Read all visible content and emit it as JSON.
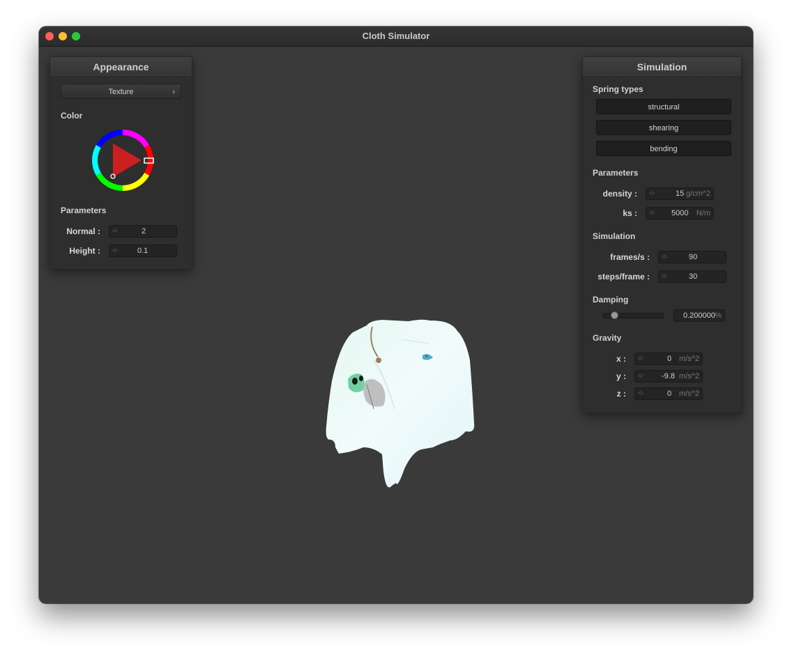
{
  "window": {
    "title": "Cloth Simulator"
  },
  "appearance": {
    "header": "Appearance",
    "texture_button": "Texture",
    "color_label": "Color",
    "parameters_label": "Parameters",
    "normal": {
      "label": "Normal :",
      "value": "2"
    },
    "height": {
      "label": "Height :",
      "value": "0.1"
    }
  },
  "simulation_panel": {
    "header": "Simulation",
    "spring_types_label": "Spring types",
    "spring_buttons": [
      "structural",
      "shearing",
      "bending"
    ],
    "parameters_label": "Parameters",
    "density": {
      "label": "density :",
      "value": "15",
      "unit": "g/cm^2"
    },
    "ks": {
      "label": "ks :",
      "value": "5000",
      "unit": "N/m"
    },
    "simulation_label": "Simulation",
    "fps": {
      "label": "frames/s :",
      "value": "90"
    },
    "steps": {
      "label": "steps/frame :",
      "value": "30"
    },
    "damping_label": "Damping",
    "damping": {
      "value": "0.200000",
      "unit": "%",
      "level": 0.2
    },
    "gravity_label": "Gravity",
    "gx": {
      "label": "x :",
      "value": "0",
      "unit": "m/s^2"
    },
    "gy": {
      "label": "y :",
      "value": "-9.8",
      "unit": "m/s^2"
    },
    "gz": {
      "label": "z :",
      "value": "0",
      "unit": "m/s^2"
    }
  },
  "colors": {
    "window_bg": "#3a3a3a",
    "panel_bg": "#2e2e2e",
    "selected_color": "#cc1f1f"
  }
}
